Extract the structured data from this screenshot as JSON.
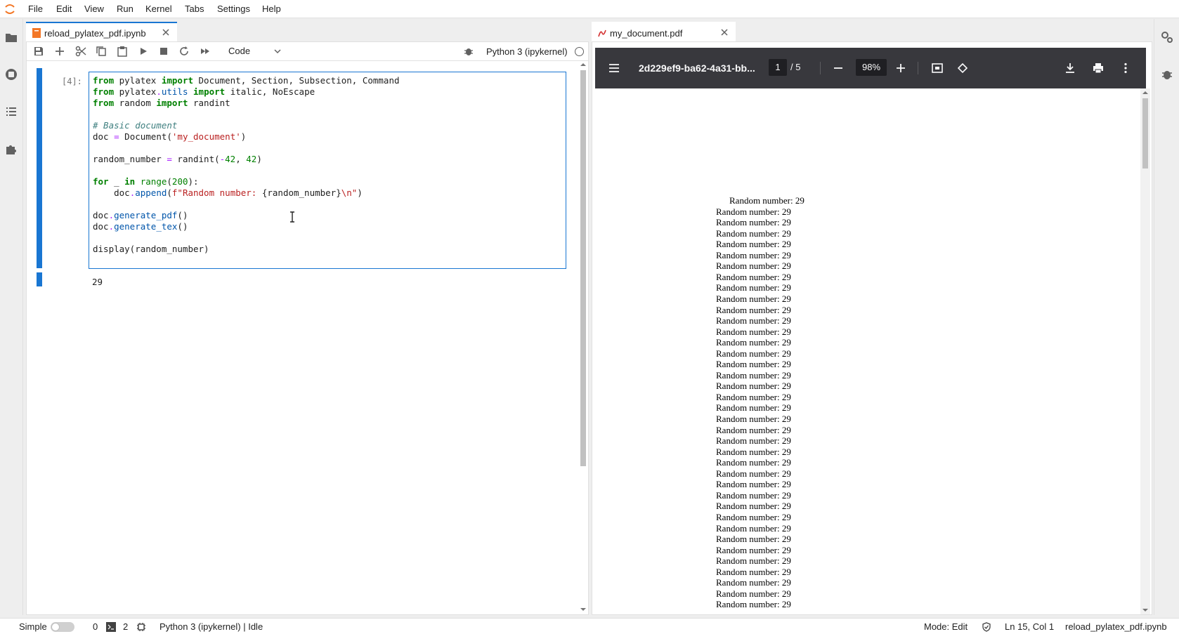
{
  "menubar": {
    "items": [
      "File",
      "Edit",
      "View",
      "Run",
      "Kernel",
      "Tabs",
      "Settings",
      "Help"
    ]
  },
  "notebook": {
    "tab_label": "reload_pylatex_pdf.ipynb",
    "celltype": "Code",
    "kernel_name": "Python 3 (ipykernel)",
    "prompt": "[4]:",
    "code_lines": [
      "from pylatex import Document, Section, Subsection, Command",
      "from pylatex.utils import italic, NoEscape",
      "from random import randint",
      "",
      "# Basic document",
      "doc = Document('my_document')",
      "",
      "random_number = randint(-42, 42)",
      "",
      "for _ in range(200):",
      "    doc.append(f\"Random number: {random_number}\\n\")",
      "",
      "doc.generate_pdf()",
      "doc.generate_tex()",
      "",
      "display(random_number)"
    ],
    "output": "29"
  },
  "pdf": {
    "tab_label": "my_document.pdf",
    "title": "2d229ef9-ba62-4a31-bb...",
    "page_current": "1",
    "page_total": "/ 5",
    "zoom": "98%",
    "line_text": "Random number: 29",
    "line_count": 38
  },
  "statusbar": {
    "mode_label": "Simple",
    "terminals_count": "0",
    "kernels_count": "2",
    "kernel_status": "Python 3 (ipykernel) | Idle",
    "edit_mode": "Mode: Edit",
    "cursor": "Ln 15, Col 1",
    "filename": "reload_pylatex_pdf.ipynb"
  },
  "colors": {
    "accent": "#1976d2",
    "pdf_toolbar": "#38383d"
  }
}
